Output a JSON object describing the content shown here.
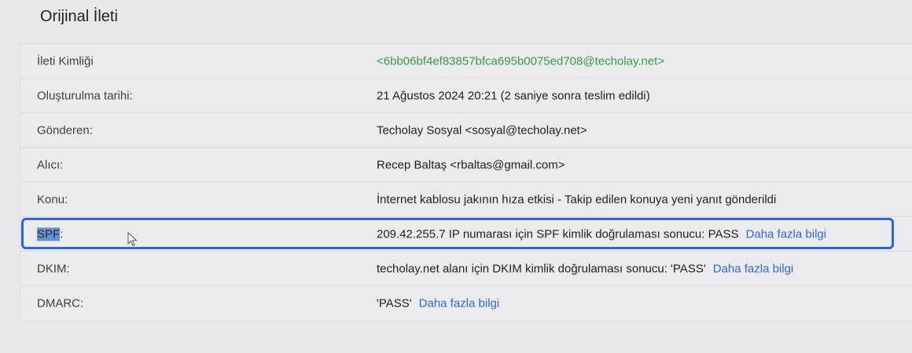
{
  "header": {
    "title": "Orijinal İleti"
  },
  "rows": [
    {
      "label": "İleti Kimliği",
      "value": "<6bb06bf4ef83857bfca695b0075ed708@techolay.net>",
      "link": ""
    },
    {
      "label": "Oluşturulma tarihi:",
      "value": "21 Ağustos 2024 20:21 (2 saniye sonra teslim edildi)",
      "link": ""
    },
    {
      "label": "Gönderen:",
      "value": "Techolay Sosyal <sosyal@techolay.net>",
      "link": ""
    },
    {
      "label": "Alıcı:",
      "value": "Recep Baltaş <rbaltas@gmail.com>",
      "link": ""
    },
    {
      "label": "Konu:",
      "value": "İnternet kablosu jakının hıza etkisi - Takip edilen konuya yeni yanıt gönderildi",
      "link": ""
    },
    {
      "label_selected": "SPF",
      "label_rest": ":",
      "value": "209.42.255.7 IP numarası için SPF kimlik doğrulaması sonucu: PASS",
      "link": "Daha fazla bilgi"
    },
    {
      "label": "DKIM:",
      "value": "techolay.net alanı için DKIM kimlik doğrulaması sonucu: 'PASS'",
      "link": "Daha fazla bilgi"
    },
    {
      "label": "DMARC:",
      "value": "'PASS'",
      "link": "Daha fazla bilgi"
    }
  ],
  "colors": {
    "message_id_green": "#3c9a46",
    "link_blue": "#3367d6",
    "highlight_border": "#2f63e6"
  }
}
